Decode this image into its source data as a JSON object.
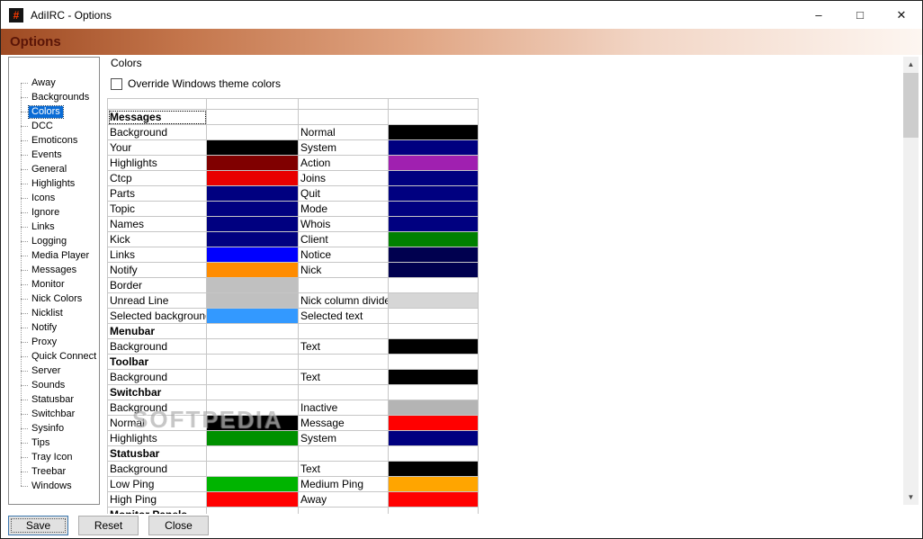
{
  "window": {
    "title": "AdiIRC - Options",
    "icon_glyph": "#",
    "controls": {
      "minimize": "–",
      "maximize": "□",
      "close": "✕"
    }
  },
  "banner": {
    "title": "Options"
  },
  "sidebar": {
    "items": [
      {
        "label": "Away"
      },
      {
        "label": "Backgrounds"
      },
      {
        "label": "Colors",
        "selected": true
      },
      {
        "label": "DCC"
      },
      {
        "label": "Emoticons"
      },
      {
        "label": "Events"
      },
      {
        "label": "General"
      },
      {
        "label": "Highlights"
      },
      {
        "label": "Icons"
      },
      {
        "label": "Ignore"
      },
      {
        "label": "Links"
      },
      {
        "label": "Logging"
      },
      {
        "label": "Media Player"
      },
      {
        "label": "Messages"
      },
      {
        "label": "Monitor"
      },
      {
        "label": "Nick Colors"
      },
      {
        "label": "Nicklist"
      },
      {
        "label": "Notify"
      },
      {
        "label": "Proxy"
      },
      {
        "label": "Quick Connect"
      },
      {
        "label": "Server"
      },
      {
        "label": "Sounds"
      },
      {
        "label": "Statusbar"
      },
      {
        "label": "Switchbar"
      },
      {
        "label": "Sysinfo"
      },
      {
        "label": "Tips"
      },
      {
        "label": "Tray Icon"
      },
      {
        "label": "Treebar"
      },
      {
        "label": "Windows"
      }
    ]
  },
  "content": {
    "panel_label": "Colors",
    "override_checkbox": {
      "label": "Override Windows theme colors",
      "checked": false
    },
    "color_table": {
      "rows": [
        {
          "type": "empty"
        },
        {
          "type": "section",
          "label": "Messages",
          "focused": true
        },
        {
          "type": "colors",
          "cells": [
            {
              "label": "Background",
              "color": "#FFFFFF"
            },
            {
              "label": "Normal",
              "color": "#000000"
            }
          ]
        },
        {
          "type": "colors",
          "cells": [
            {
              "label": "Your",
              "color": "#000000"
            },
            {
              "label": "System",
              "color": "#000080"
            }
          ]
        },
        {
          "type": "colors",
          "cells": [
            {
              "label": "Highlights",
              "color": "#800000"
            },
            {
              "label": "Action",
              "color": "#A020B0"
            }
          ]
        },
        {
          "type": "colors",
          "cells": [
            {
              "label": "Ctcp",
              "color": "#E80000"
            },
            {
              "label": "Joins",
              "color": "#000080"
            }
          ]
        },
        {
          "type": "colors",
          "cells": [
            {
              "label": "Parts",
              "color": "#000080"
            },
            {
              "label": "Quit",
              "color": "#000080"
            }
          ]
        },
        {
          "type": "colors",
          "cells": [
            {
              "label": "Topic",
              "color": "#000080"
            },
            {
              "label": "Mode",
              "color": "#000080"
            }
          ]
        },
        {
          "type": "colors",
          "cells": [
            {
              "label": "Names",
              "color": "#000080"
            },
            {
              "label": "Whois",
              "color": "#000080"
            }
          ]
        },
        {
          "type": "colors",
          "cells": [
            {
              "label": "Kick",
              "color": "#000080"
            },
            {
              "label": "Client",
              "color": "#008000"
            }
          ]
        },
        {
          "type": "colors",
          "cells": [
            {
              "label": "Links",
              "color": "#0000FF"
            },
            {
              "label": "Notice",
              "color": "#00004F"
            }
          ]
        },
        {
          "type": "colors",
          "cells": [
            {
              "label": "Notify",
              "color": "#FF8C00"
            },
            {
              "label": "Nick",
              "color": "#00004F"
            }
          ]
        },
        {
          "type": "colors",
          "cells": [
            {
              "label": "Border",
              "color": "#C0C0C0"
            },
            {
              "label": "",
              "color": ""
            }
          ]
        },
        {
          "type": "colors",
          "cells": [
            {
              "label": "Unread Line",
              "color": "#C0C0C0"
            },
            {
              "label": "Nick column divider",
              "color": "#D6D6D6"
            }
          ]
        },
        {
          "type": "colors",
          "cells": [
            {
              "label": "Selected background",
              "color": "#3399FF"
            },
            {
              "label": "Selected text",
              "color": "#FFFFFF"
            }
          ]
        },
        {
          "type": "section",
          "label": "Menubar"
        },
        {
          "type": "colors",
          "cells": [
            {
              "label": "Background",
              "color": "#FFFFFF"
            },
            {
              "label": "Text",
              "color": "#000000"
            }
          ]
        },
        {
          "type": "section",
          "label": "Toolbar"
        },
        {
          "type": "colors",
          "cells": [
            {
              "label": "Background",
              "color": "#FFFFFF"
            },
            {
              "label": "Text",
              "color": "#000000"
            }
          ]
        },
        {
          "type": "section",
          "label": "Switchbar"
        },
        {
          "type": "colors",
          "cells": [
            {
              "label": "Background",
              "color": "#FFFFFF"
            },
            {
              "label": "Inactive",
              "color": "#B4B4B4"
            }
          ]
        },
        {
          "type": "colors",
          "cells": [
            {
              "label": "Normal",
              "color": "#000000"
            },
            {
              "label": "Message",
              "color": "#FF0000"
            }
          ]
        },
        {
          "type": "colors",
          "cells": [
            {
              "label": "Highlights",
              "color": "#009100"
            },
            {
              "label": "System",
              "color": "#000080"
            }
          ]
        },
        {
          "type": "section",
          "label": "Statusbar"
        },
        {
          "type": "colors",
          "cells": [
            {
              "label": "Background",
              "color": "#FFFFFF"
            },
            {
              "label": "Text",
              "color": "#000000"
            }
          ]
        },
        {
          "type": "colors",
          "cells": [
            {
              "label": "Low Ping",
              "color": "#00B400"
            },
            {
              "label": "Medium Ping",
              "color": "#FFA500"
            }
          ]
        },
        {
          "type": "colors",
          "cells": [
            {
              "label": "High Ping",
              "color": "#FF0000"
            },
            {
              "label": "Away",
              "color": "#FF0000"
            }
          ]
        },
        {
          "type": "section",
          "label": "Monitor Panels"
        }
      ]
    }
  },
  "scrollbar": {
    "up": "▲",
    "down": "▼"
  },
  "footer": {
    "buttons": [
      {
        "label": "Save",
        "default": true
      },
      {
        "label": "Reset"
      },
      {
        "label": "Close"
      }
    ]
  },
  "watermark": "SOFTPEDIA"
}
